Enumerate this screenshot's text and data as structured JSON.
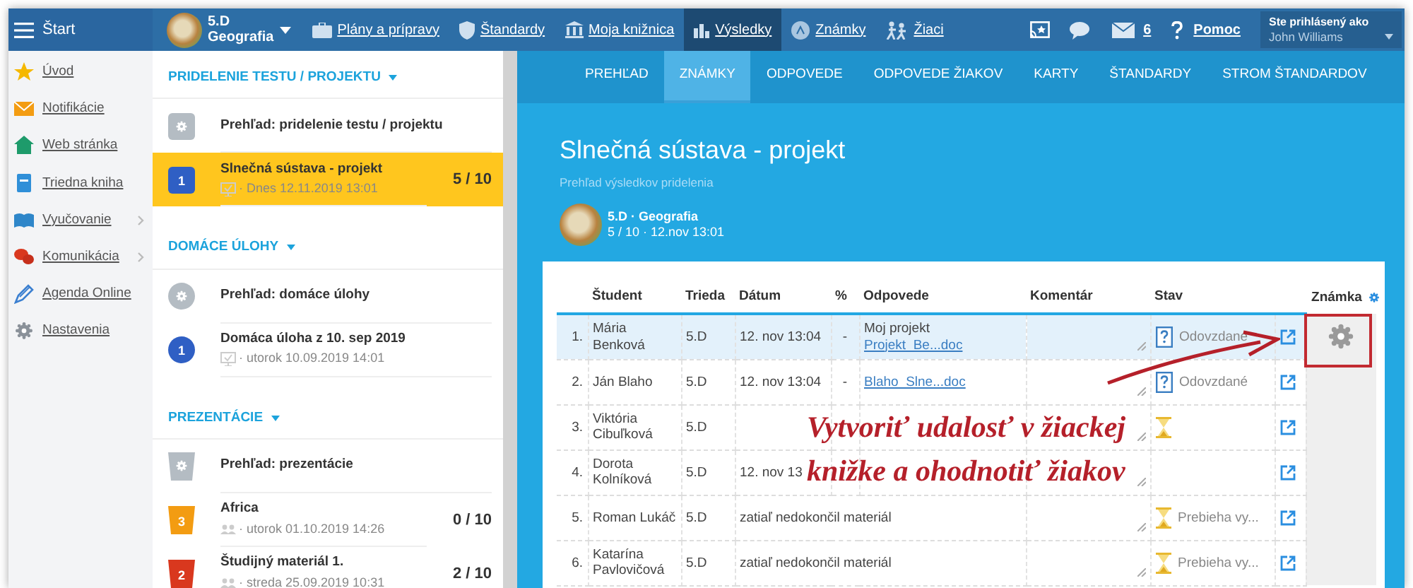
{
  "topbar": {
    "menu_label": "Štart",
    "class_code": "5.D",
    "class_subject": "Geografia",
    "nav": [
      {
        "label": "Plány a prípravy",
        "selected": false
      },
      {
        "label": "Štandardy",
        "selected": false
      },
      {
        "label": "Moja knižnica",
        "selected": false
      },
      {
        "label": "Výsledky",
        "selected": true
      },
      {
        "label": "Známky",
        "selected": false
      },
      {
        "label": "Žiaci",
        "selected": false
      }
    ],
    "messages_count": "6",
    "help_label": "Pomoc",
    "login_caption": "Ste prihlásený ako",
    "user_name": "John Williams"
  },
  "sidebar": {
    "items": [
      {
        "label": "Úvod",
        "has_submenu": false
      },
      {
        "label": "Notifikácie",
        "has_submenu": false
      },
      {
        "label": "Web stránka",
        "has_submenu": false
      },
      {
        "label": "Triedna kniha",
        "has_submenu": false
      },
      {
        "label": "Vyučovanie",
        "has_submenu": true
      },
      {
        "label": "Komunikácia",
        "has_submenu": true
      },
      {
        "label": "Agenda Online",
        "has_submenu": false
      },
      {
        "label": "Nastavenia",
        "has_submenu": false
      }
    ]
  },
  "sections": [
    {
      "title": "PRIDELENIE TESTU / PROJEKTU",
      "items": [
        {
          "kind": "overview",
          "title": "Prehľad: pridelenie testu / projektu",
          "selected": false
        },
        {
          "kind": "entry",
          "badge": "1",
          "color": "#2f5fc4",
          "title": "Slnečná sústava - projekt",
          "date": "· Dnes 12.11.2019 13:01",
          "score": "5 / 10",
          "selected": true
        }
      ]
    },
    {
      "title": "DOMÁCE ÚLOHY",
      "items": [
        {
          "kind": "overview",
          "title": "Prehľad: domáce úlohy",
          "selected": false
        },
        {
          "kind": "entry",
          "badge": "1",
          "color": "#2f5fc4",
          "title": "Domáca úloha z 10. sep 2019",
          "date": "· utorok 10.09.2019 14:01",
          "selected": false
        }
      ]
    },
    {
      "title": "PREZENTÁCIE",
      "items": [
        {
          "kind": "overview",
          "title": "Prehľad: prezentácie",
          "selected": false
        },
        {
          "kind": "entry",
          "badge": "3",
          "color": "#f39c12",
          "title": "Africa",
          "date": "· utorok 01.10.2019 14:26",
          "score": "0 / 10",
          "selected": false
        },
        {
          "kind": "entry",
          "badge": "2",
          "color": "#d9381e",
          "title": "Študijný materiál 1.",
          "date": "· streda 25.09.2019 10:31",
          "score": "2 / 10",
          "selected": false
        }
      ]
    }
  ],
  "tabs": [
    {
      "label": "PREHĽAD",
      "selected": false
    },
    {
      "label": "ZNÁMKY",
      "selected": true
    },
    {
      "label": "ODPOVEDE",
      "selected": false
    },
    {
      "label": "ODPOVEDE ŽIAKOV",
      "selected": false
    },
    {
      "label": "KARTY",
      "selected": false
    },
    {
      "label": "ŠTANDARDY",
      "selected": false
    },
    {
      "label": "STROM ŠTANDARDOV",
      "selected": false
    }
  ],
  "header": {
    "title": "Slnečná sústava - projekt",
    "subtitle": "Prehľad výsledkov pridelenia",
    "class_line": "5.D · Geografia",
    "info_line": "5 / 10 · 12.nov 13:01"
  },
  "table": {
    "columns": [
      "Študent",
      "Trieda",
      "Dátum",
      "%",
      "Odpovede",
      "Komentár",
      "Stav",
      "Známka"
    ],
    "rows": [
      {
        "number": "1.",
        "student": "Mária Benková",
        "class": "5.D",
        "date": "12. nov 13:04",
        "percent": "-",
        "answer_title": "Moj projekt",
        "answer_file": "Projekt_Be...doc",
        "kind": "submitted",
        "status": "Odovzdané",
        "selected": true
      },
      {
        "number": "2.",
        "student": "Ján Blaho",
        "class": "5.D",
        "date": "12. nov 13:04",
        "percent": "-",
        "answer_file": "Blaho_Slne...doc",
        "kind": "submitted",
        "status": "Odovzdané",
        "selected": false
      },
      {
        "number": "3.",
        "student": "Viktória Cibuľková",
        "class": "5.D",
        "kind": "in_progress",
        "selected": false
      },
      {
        "number": "4.",
        "student": "Dorota Kolníková",
        "class": "5.D",
        "date": "12. nov 13",
        "selected": false
      },
      {
        "number": "5.",
        "student": "Roman Lukáč",
        "class": "5.D",
        "pending": "zatiaľ nedokončil materiál",
        "kind": "in_progress",
        "status": "Prebieha vy...",
        "selected": false
      },
      {
        "number": "6.",
        "student": "Katarína Pavlovičová",
        "class": "5.D",
        "pending": "zatiaľ nedokončil materiál",
        "kind": "in_progress",
        "status": "Prebieha vy...",
        "selected": false
      }
    ]
  },
  "annotation": {
    "line_1": "Vytvoriť udalosť v žiackej",
    "line_2": "knižke a ohodnotiť žiakov"
  }
}
